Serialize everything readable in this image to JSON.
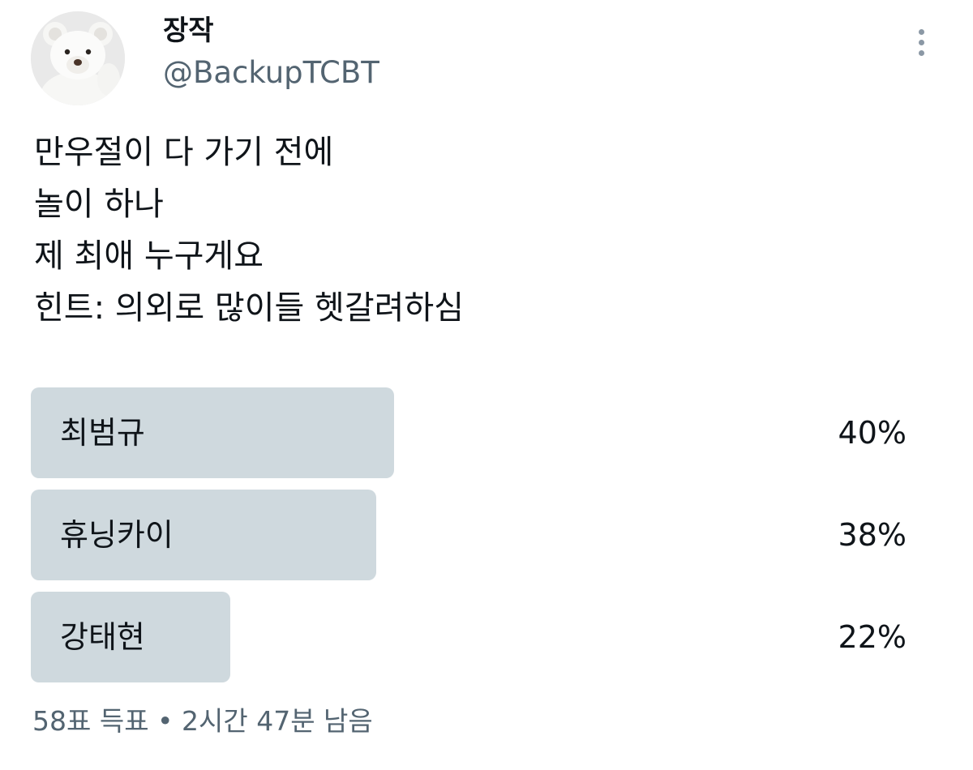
{
  "author": {
    "display_name": "장작",
    "handle": "@BackupTCBT",
    "avatar_icon": "white-teddy-bear-avatar"
  },
  "more_icon": "vertical-ellipsis-icon",
  "tweet": {
    "lines": [
      "만우절이 다 가기 전에",
      "놀이 하나",
      "제 최애 누구게요",
      "힌트: 의외로 많이들 헷갈려하심"
    ]
  },
  "poll": {
    "options": [
      {
        "label": "최범규",
        "percent_text": "40%",
        "percent": 40
      },
      {
        "label": "휴닝카이",
        "percent_text": "38%",
        "percent": 38
      },
      {
        "label": "강태현",
        "percent_text": "22%",
        "percent": 22
      }
    ],
    "meta": "58표 득표 • 2시간 47분 남음"
  },
  "colors": {
    "bar": "#cfd9de",
    "secondary_text": "#536471",
    "primary_text": "#0f1419"
  }
}
